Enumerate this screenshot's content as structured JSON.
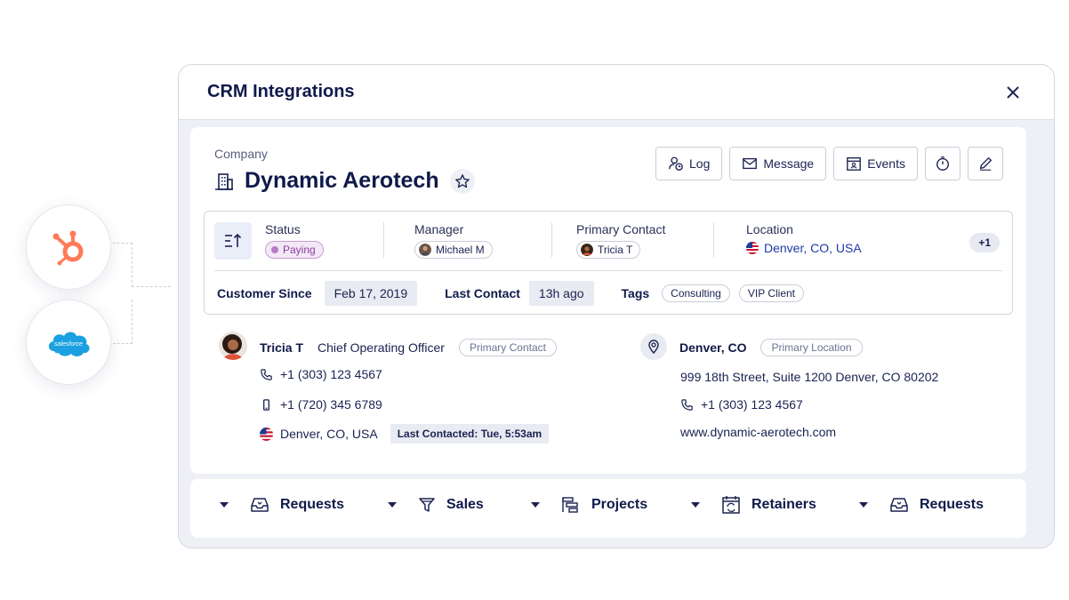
{
  "window": {
    "title": "CRM Integrations"
  },
  "integrations": [
    {
      "name": "hubspot-logo",
      "color": "#ff7a59"
    },
    {
      "name": "salesforce-logo",
      "label": "salesforce",
      "color": "#1ba1e2"
    }
  ],
  "company": {
    "label": "Company",
    "name": "Dynamic Aerotech"
  },
  "actions": {
    "log": "Log",
    "message": "Message",
    "events": "Events"
  },
  "info": {
    "status_label": "Status",
    "status_value": "Paying",
    "manager_label": "Manager",
    "manager_value": "Michael M",
    "primary_contact_label": "Primary Contact",
    "primary_contact_value": "Tricia T",
    "location_label": "Location",
    "location_value": "Denver, CO, USA",
    "more_count": "+1",
    "customer_since_label": "Customer Since",
    "customer_since_value": "Feb 17, 2019",
    "last_contact_label": "Last Contact",
    "last_contact_value": "13h ago",
    "tags_label": "Tags",
    "tags": [
      "Consulting",
      "VIP Client"
    ]
  },
  "contact": {
    "name": "Tricia T",
    "title": "Chief Operating Officer",
    "badge": "Primary Contact",
    "phone": "+1 (303) 123 4567",
    "mobile": "+1 (720) 345 6789",
    "location": "Denver, CO, USA",
    "last_contacted": "Last Contacted: Tue, 5:53am"
  },
  "location_card": {
    "name": "Denver, CO",
    "badge": "Primary Location",
    "address": "999 18th Street, Suite 1200 Denver, CO 80202",
    "phone": "+1 (303) 123 4567",
    "website": "www.dynamic-aerotech.com"
  },
  "tabs": [
    {
      "label": "Requests",
      "icon": "inbox-icon"
    },
    {
      "label": "Sales",
      "icon": "funnel-icon"
    },
    {
      "label": "Projects",
      "icon": "gantt-icon"
    },
    {
      "label": "Retainers",
      "icon": "calendar-refresh-icon"
    },
    {
      "label": "Requests",
      "icon": "inbox-icon"
    }
  ]
}
